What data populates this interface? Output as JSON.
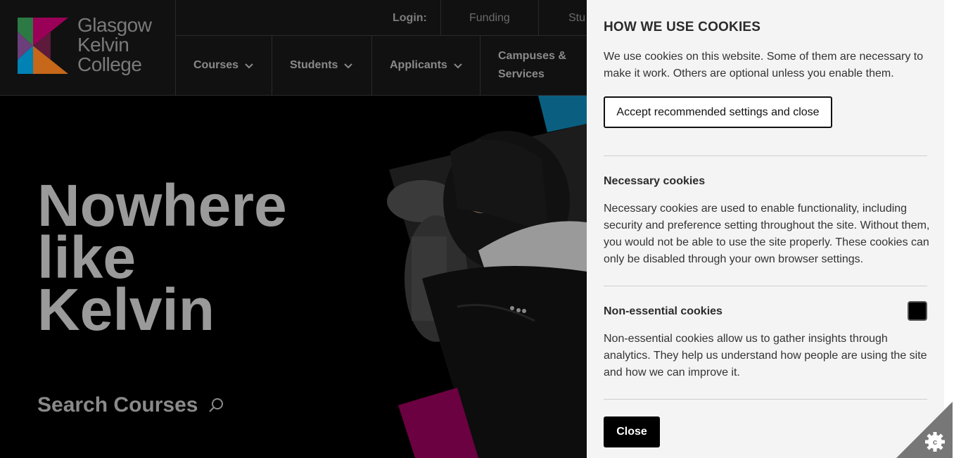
{
  "logo": {
    "line1": "Glasgow",
    "line2": "Kelvin",
    "line3": "College"
  },
  "topbar": {
    "login_label": "Login:",
    "links": [
      "Funding",
      "Stu"
    ]
  },
  "nav": {
    "courses": "Courses",
    "students": "Students",
    "applicants": "Applicants",
    "campuses_line1": "Campuses &",
    "campuses_line2": "Services"
  },
  "hero": {
    "line1": "Nowhere",
    "line2": "like",
    "line3": "Kelvin",
    "search_label": "Search Courses"
  },
  "cookies": {
    "title": "HOW WE USE COOKIES",
    "intro": "We use cookies on this website. Some of them are necessary to make it work. Others are optional unless you enable them.",
    "accept_label": "Accept recommended settings and close",
    "necessary_title": "Necessary cookies",
    "necessary_text": "Necessary cookies are used to enable functionality, including security and preference setting throughout the site. Without them, you would not be able to use the site properly. These cookies can only be disabled through your own browser settings.",
    "nonessential_title": "Non-essential cookies",
    "nonessential_text": "Non-essential cookies allow us to gather insights through analytics. They help us understand how people are using the site and how we can improve it.",
    "nonessential_enabled": false,
    "close_label": "Close"
  },
  "colors": {
    "magenta": "#9b0058",
    "blue": "#0082b4",
    "orange": "#c7671a",
    "green": "#2c7a43",
    "panel_bg": "#f4f4f4",
    "corner_bg": "#777777"
  },
  "icons": {
    "search": "search-icon",
    "chevron": "chevron-down-icon",
    "cookie_settings": "cookie-settings-icon"
  }
}
